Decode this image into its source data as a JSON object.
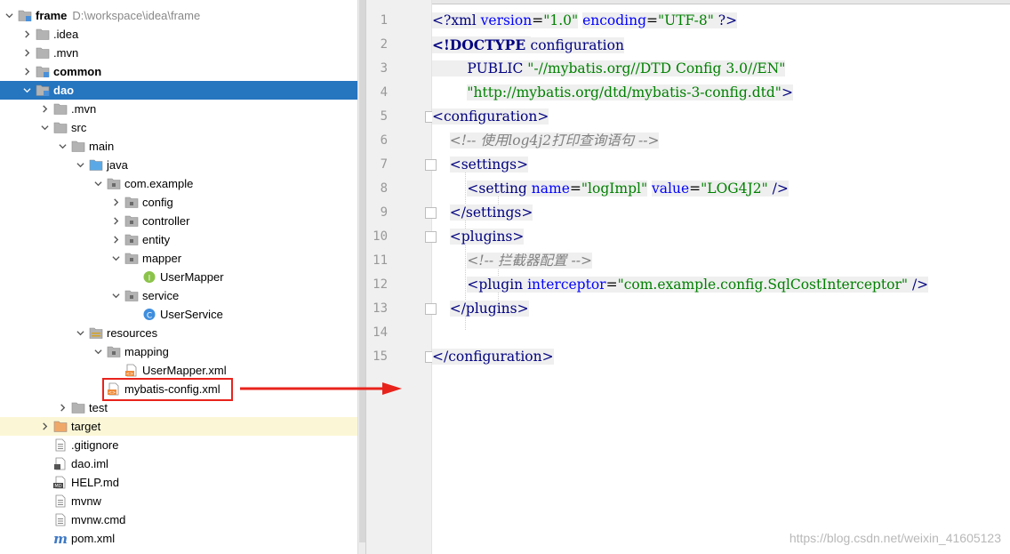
{
  "tree": {
    "items": [
      {
        "label": "frame",
        "path": "D:\\workspace\\idea\\frame",
        "icon": "module-folder",
        "depth": 0,
        "expanded": true,
        "bold": true
      },
      {
        "label": ".idea",
        "icon": "folder",
        "depth": 1,
        "expanded": false
      },
      {
        "label": ".mvn",
        "icon": "folder",
        "depth": 1,
        "expanded": false
      },
      {
        "label": "common",
        "icon": "module-folder",
        "depth": 1,
        "expanded": false,
        "bold": true
      },
      {
        "label": "dao",
        "icon": "module-folder",
        "depth": 1,
        "expanded": true,
        "bold": true,
        "selected": true
      },
      {
        "label": ".mvn",
        "icon": "folder",
        "depth": 2,
        "expanded": false
      },
      {
        "label": "src",
        "icon": "folder",
        "depth": 2,
        "expanded": true
      },
      {
        "label": "main",
        "icon": "folder",
        "depth": 3,
        "expanded": true
      },
      {
        "label": "java",
        "icon": "source-folder",
        "depth": 4,
        "expanded": true
      },
      {
        "label": "com.example",
        "icon": "package",
        "depth": 5,
        "expanded": true
      },
      {
        "label": "config",
        "icon": "package",
        "depth": 6,
        "expanded": false
      },
      {
        "label": "controller",
        "icon": "package",
        "depth": 6,
        "expanded": false
      },
      {
        "label": "entity",
        "icon": "package",
        "depth": 6,
        "expanded": false
      },
      {
        "label": "mapper",
        "icon": "package",
        "depth": 6,
        "expanded": true
      },
      {
        "label": "UserMapper",
        "icon": "interface",
        "depth": 7
      },
      {
        "label": "service",
        "icon": "package",
        "depth": 6,
        "expanded": true
      },
      {
        "label": "UserService",
        "icon": "class",
        "depth": 7
      },
      {
        "label": "resources",
        "icon": "resources-folder",
        "depth": 4,
        "expanded": true
      },
      {
        "label": "mapping",
        "icon": "package",
        "depth": 5,
        "expanded": true
      },
      {
        "label": "UserMapper.xml",
        "icon": "xml-file",
        "depth": 6
      },
      {
        "label": "mybatis-config.xml",
        "icon": "xml-file",
        "depth": 5,
        "annotated": true
      },
      {
        "label": "test",
        "icon": "folder",
        "depth": 3,
        "expanded": false
      },
      {
        "label": "target",
        "icon": "excluded-folder",
        "depth": 2,
        "expanded": false,
        "excluded": true
      },
      {
        "label": ".gitignore",
        "icon": "text-file",
        "depth": 2
      },
      {
        "label": "dao.iml",
        "icon": "iml-file",
        "depth": 2
      },
      {
        "label": "HELP.md",
        "icon": "md-file",
        "depth": 2
      },
      {
        "label": "mvnw",
        "icon": "text-file",
        "depth": 2
      },
      {
        "label": "mvnw.cmd",
        "icon": "text-file",
        "depth": 2
      },
      {
        "label": "pom.xml",
        "icon": "maven-file",
        "depth": 2
      }
    ]
  },
  "editor": {
    "line_numbers": [
      "1",
      "2",
      "3",
      "4",
      "5",
      "6",
      "7",
      "8",
      "9",
      "10",
      "11",
      "12",
      "13",
      "14",
      "15"
    ],
    "lines": [
      [
        {
          "t": "<?",
          "c": "tag"
        },
        {
          "t": "xml ",
          "c": "tag"
        },
        {
          "t": "version",
          "c": "attr"
        },
        {
          "t": "=",
          "c": "pl"
        },
        {
          "t": "\"1.0\"",
          "c": "val"
        },
        {
          "t": " ",
          "c": "pl"
        },
        {
          "t": "encoding",
          "c": "attr"
        },
        {
          "t": "=",
          "c": "pl"
        },
        {
          "t": "\"UTF-8\"",
          "c": "val"
        },
        {
          "t": " ?>",
          "c": "tag"
        }
      ],
      [
        {
          "t": "<!DOCTYPE ",
          "c": "kw"
        },
        {
          "t": "configuration",
          "c": "tag"
        }
      ],
      [
        {
          "t": "        PUBLIC ",
          "c": "tag"
        },
        {
          "t": "\"-//mybatis.org//DTD Config 3.0//EN\"",
          "c": "val"
        }
      ],
      [
        {
          "t": "        ",
          "c": "pl"
        },
        {
          "t": "\"http://mybatis.org/dtd/mybatis-3-config.dtd\"",
          "c": "val"
        },
        {
          "t": ">",
          "c": "tag"
        }
      ],
      [
        {
          "t": "<configuration>",
          "c": "tag"
        }
      ],
      [
        {
          "t": "    ",
          "c": "pl"
        },
        {
          "t": "<!-- 使用log4j2打印查询语句 -->",
          "c": "cm"
        }
      ],
      [
        {
          "t": "    ",
          "c": "pl"
        },
        {
          "t": "<settings>",
          "c": "tag"
        }
      ],
      [
        {
          "t": "        ",
          "c": "pl"
        },
        {
          "t": "<setting ",
          "c": "tag"
        },
        {
          "t": "name",
          "c": "attr"
        },
        {
          "t": "=",
          "c": "pl"
        },
        {
          "t": "\"logImpl\"",
          "c": "val"
        },
        {
          "t": " ",
          "c": "pl"
        },
        {
          "t": "value",
          "c": "attr"
        },
        {
          "t": "=",
          "c": "pl"
        },
        {
          "t": "\"LOG4J2\"",
          "c": "val"
        },
        {
          "t": " />",
          "c": "tag"
        }
      ],
      [
        {
          "t": "    ",
          "c": "pl"
        },
        {
          "t": "</settings>",
          "c": "tag"
        }
      ],
      [
        {
          "t": "    ",
          "c": "pl"
        },
        {
          "t": "<plugins>",
          "c": "tag"
        }
      ],
      [
        {
          "t": "        ",
          "c": "pl"
        },
        {
          "t": "<!-- 拦截器配置 -->",
          "c": "cm"
        }
      ],
      [
        {
          "t": "        ",
          "c": "pl"
        },
        {
          "t": "<plugin ",
          "c": "tag"
        },
        {
          "t": "interceptor",
          "c": "attr"
        },
        {
          "t": "=",
          "c": "pl"
        },
        {
          "t": "\"com.example.config.SqlCostInterceptor\"",
          "c": "val"
        },
        {
          "t": " />",
          "c": "tag"
        }
      ],
      [
        {
          "t": "    ",
          "c": "pl"
        },
        {
          "t": "</plugins>",
          "c": "tag"
        }
      ],
      [],
      [
        {
          "t": "</configuration>",
          "c": "tag"
        }
      ]
    ],
    "watermark": "https://blog.csdn.net/weixin_41605123"
  },
  "colors": {
    "selection": "#2675bf",
    "annotation": "#e8231c",
    "excluded": "#fbf7d6"
  }
}
